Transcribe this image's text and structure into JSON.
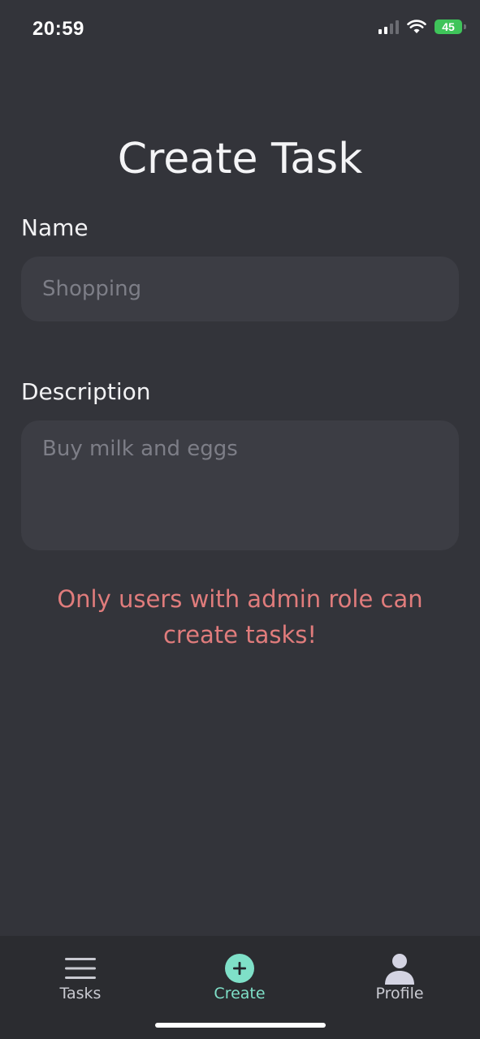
{
  "status_bar": {
    "time": "20:59",
    "battery": "45",
    "icons": [
      "signal-icon",
      "wifi-icon",
      "battery-icon"
    ]
  },
  "page": {
    "title": "Create Task"
  },
  "form": {
    "name_label": "Name",
    "name_placeholder": "Shopping",
    "name_value": "",
    "description_label": "Description",
    "description_placeholder": "Buy milk and eggs",
    "description_value": ""
  },
  "error_message": "Only users with admin role can create tasks!",
  "tab_bar": {
    "tasks": {
      "label": "Tasks",
      "icon": "menu-icon"
    },
    "create": {
      "label": "Create",
      "icon": "plus-circle-icon"
    },
    "profile": {
      "label": "Profile",
      "icon": "person-icon"
    }
  },
  "colors": {
    "background": "#33343a",
    "input_background": "#3c3d44",
    "tab_bar_background": "#2b2c30",
    "error": "#e07c7c",
    "accent": "#7fe0c8",
    "battery": "#3fc45a"
  }
}
